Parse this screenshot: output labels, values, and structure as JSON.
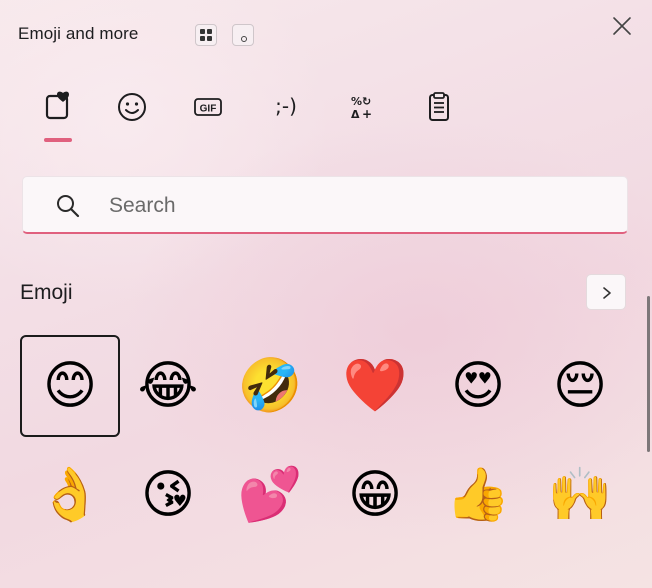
{
  "header": {
    "title": "Emoji and more",
    "buttons": [
      {
        "name": "grid-icon",
        "label": ""
      },
      {
        "name": "dot-icon",
        "label": "。"
      }
    ],
    "close_icon": "close-icon"
  },
  "tabs": [
    {
      "name": "tab-favorites",
      "icon": "heart-square-icon",
      "selected": true
    },
    {
      "name": "tab-emoji",
      "icon": "smiley-icon",
      "selected": false
    },
    {
      "name": "tab-gif",
      "icon": "gif-icon",
      "label": "GIF",
      "selected": false
    },
    {
      "name": "tab-kaomoji",
      "icon": "kaomoji-icon",
      "label": ";-)",
      "selected": false
    },
    {
      "name": "tab-symbols",
      "icon": "symbols-icon",
      "label": "%↻\nΔ+",
      "selected": false
    },
    {
      "name": "tab-clipboard",
      "icon": "clipboard-icon",
      "selected": false
    }
  ],
  "search": {
    "placeholder": "Search",
    "value": ""
  },
  "section": {
    "title": "Emoji",
    "next_icon": "chevron-right-icon"
  },
  "emojis": [
    {
      "name": "smiling-face-with-smiling-eyes",
      "char": "😊",
      "selected": true
    },
    {
      "name": "face-with-tears-of-joy",
      "char": "😂",
      "selected": false
    },
    {
      "name": "rolling-on-the-floor-laughing",
      "char": "🤣",
      "selected": false
    },
    {
      "name": "red-heart",
      "char": "❤️",
      "selected": false
    },
    {
      "name": "smiling-face-with-heart-eyes",
      "char": "😍",
      "selected": false
    },
    {
      "name": "pensive-face",
      "char": "😔",
      "selected": false
    },
    {
      "name": "ok-hand",
      "char": "👌",
      "selected": false
    },
    {
      "name": "face-blowing-a-kiss",
      "char": "😘",
      "selected": false
    },
    {
      "name": "two-hearts",
      "char": "💕",
      "selected": false
    },
    {
      "name": "beaming-face-with-smiling-eyes",
      "char": "😁",
      "selected": false
    },
    {
      "name": "thumbs-up",
      "char": "👍",
      "selected": false
    },
    {
      "name": "raising-hands",
      "char": "🙌",
      "selected": false
    }
  ],
  "colors": {
    "accent": "#e0607e",
    "text": "#1d1d1f",
    "selected_border": "#1b1b1b"
  }
}
